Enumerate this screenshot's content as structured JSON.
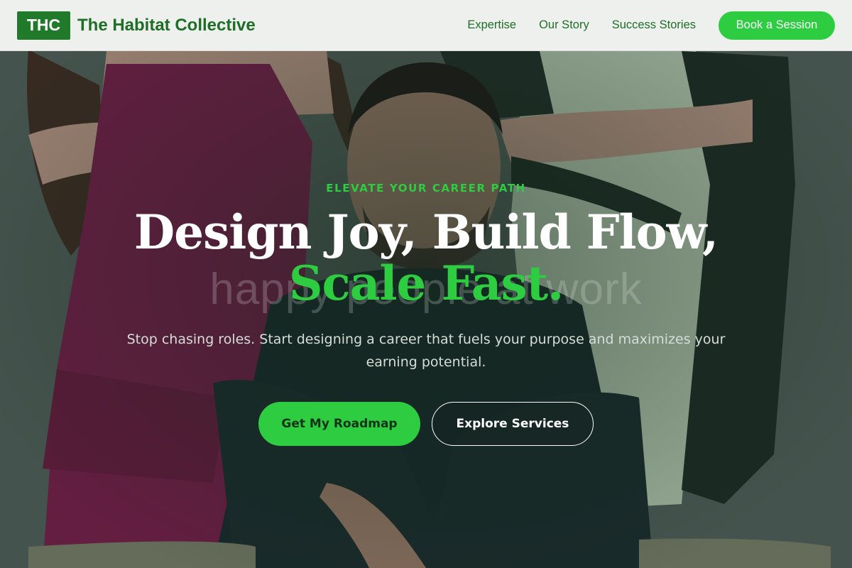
{
  "header": {
    "logo_text": "THC",
    "brand_name": "The Habitat Collective",
    "nav": [
      {
        "label": "Expertise"
      },
      {
        "label": "Our Story"
      },
      {
        "label": "Success Stories"
      }
    ],
    "cta_label": "Book a Session"
  },
  "hero": {
    "eyebrow": "ELEVATE YOUR CAREER PATH",
    "headline_line1": "Design Joy, Build Flow,",
    "headline_line2": "Scale Fast.",
    "background_text": "happy people at work",
    "subtext": "Stop chasing roles. Start designing a career that fuels your purpose and maximizes your earning potential.",
    "primary_cta": "Get My Roadmap",
    "secondary_cta": "Explore Services"
  },
  "colors": {
    "accent": "#2ecc40",
    "brand_dark": "#217a2a",
    "header_bg": "#eef0ee"
  }
}
